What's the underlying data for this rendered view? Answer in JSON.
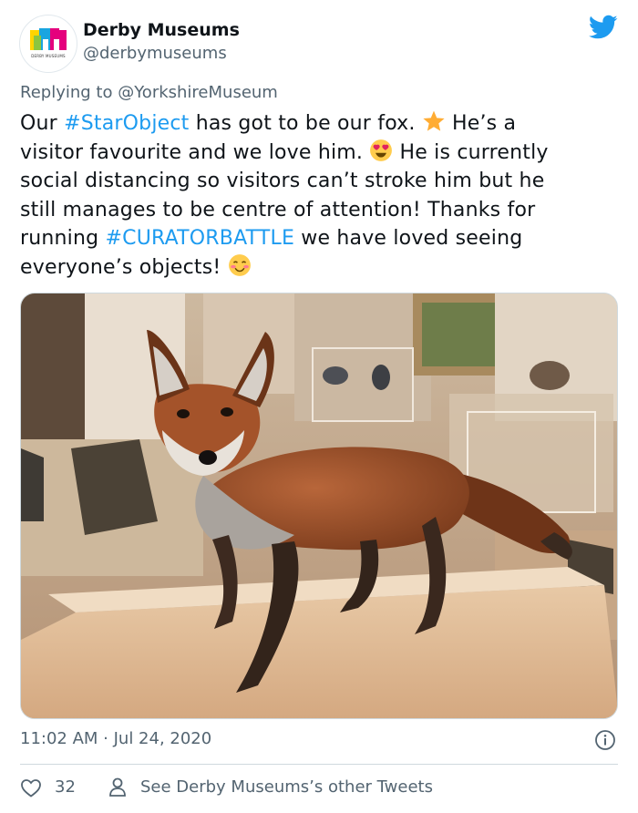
{
  "author": {
    "display_name": "Derby Museums",
    "handle": "@derbymuseums",
    "avatar_caption": "DERBY MUSEUMS",
    "avatar_icon": "derby-museums-logo-icon"
  },
  "platform_icon": "twitter-bird-icon",
  "reply": {
    "prefix": "Replying to ",
    "mention": "@YorkshireMuseum"
  },
  "tweet": {
    "line1": {
      "a": "Our ",
      "tag": "#StarObject",
      "b": " has got to be our fox. ",
      "emoji": "star-emoji",
      "c": " He’s a"
    },
    "line2": {
      "a": "visitor favourite and we love him. ",
      "emoji": "heart-eyes-emoji",
      "b": " He is currently"
    },
    "line3": "social distancing so visitors can’t stroke him but he",
    "line4": "still manages to be centre of attention! Thanks for",
    "line5": {
      "a": "running ",
      "tag": "#CURATORBATTLE",
      "b": " we have loved seeing"
    },
    "line6": {
      "a": "everyone’s objects! ",
      "emoji": "smiling-blush-emoji"
    }
  },
  "photo": {
    "subject": "taxidermy-fox-in-museum-gallery"
  },
  "timestamp": "11:02 AM · Jul 24, 2020",
  "info_icon": "info-icon",
  "actions": {
    "likes": "32",
    "like_icon": "heart-outline-icon",
    "other_tweets_icon": "person-icon",
    "other_tweets_label": "See Derby Museums’s other Tweets"
  },
  "colors": {
    "link": "#1d9bf0",
    "secondary_text": "#536471",
    "primary_text": "#0f1419",
    "twitter_blue": "#1d9bf0"
  }
}
